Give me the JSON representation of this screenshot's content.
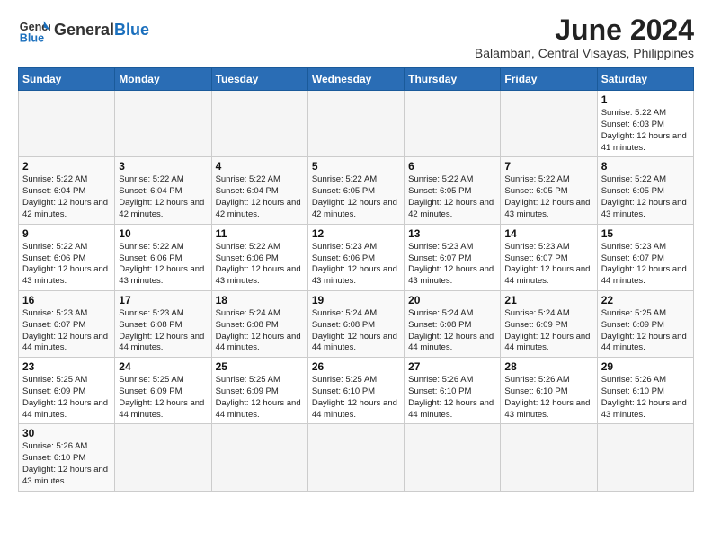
{
  "header": {
    "logo_general": "General",
    "logo_blue": "Blue",
    "month_year": "June 2024",
    "location": "Balamban, Central Visayas, Philippines"
  },
  "weekdays": [
    "Sunday",
    "Monday",
    "Tuesday",
    "Wednesday",
    "Thursday",
    "Friday",
    "Saturday"
  ],
  "weeks": [
    [
      {
        "day": "",
        "info": ""
      },
      {
        "day": "",
        "info": ""
      },
      {
        "day": "",
        "info": ""
      },
      {
        "day": "",
        "info": ""
      },
      {
        "day": "",
        "info": ""
      },
      {
        "day": "",
        "info": ""
      },
      {
        "day": "1",
        "info": "Sunrise: 5:22 AM\nSunset: 6:03 PM\nDaylight: 12 hours and 41 minutes."
      }
    ],
    [
      {
        "day": "2",
        "info": "Sunrise: 5:22 AM\nSunset: 6:04 PM\nDaylight: 12 hours and 42 minutes."
      },
      {
        "day": "3",
        "info": "Sunrise: 5:22 AM\nSunset: 6:04 PM\nDaylight: 12 hours and 42 minutes."
      },
      {
        "day": "4",
        "info": "Sunrise: 5:22 AM\nSunset: 6:04 PM\nDaylight: 12 hours and 42 minutes."
      },
      {
        "day": "5",
        "info": "Sunrise: 5:22 AM\nSunset: 6:05 PM\nDaylight: 12 hours and 42 minutes."
      },
      {
        "day": "6",
        "info": "Sunrise: 5:22 AM\nSunset: 6:05 PM\nDaylight: 12 hours and 42 minutes."
      },
      {
        "day": "7",
        "info": "Sunrise: 5:22 AM\nSunset: 6:05 PM\nDaylight: 12 hours and 43 minutes."
      },
      {
        "day": "8",
        "info": "Sunrise: 5:22 AM\nSunset: 6:05 PM\nDaylight: 12 hours and 43 minutes."
      }
    ],
    [
      {
        "day": "9",
        "info": "Sunrise: 5:22 AM\nSunset: 6:06 PM\nDaylight: 12 hours and 43 minutes."
      },
      {
        "day": "10",
        "info": "Sunrise: 5:22 AM\nSunset: 6:06 PM\nDaylight: 12 hours and 43 minutes."
      },
      {
        "day": "11",
        "info": "Sunrise: 5:22 AM\nSunset: 6:06 PM\nDaylight: 12 hours and 43 minutes."
      },
      {
        "day": "12",
        "info": "Sunrise: 5:23 AM\nSunset: 6:06 PM\nDaylight: 12 hours and 43 minutes."
      },
      {
        "day": "13",
        "info": "Sunrise: 5:23 AM\nSunset: 6:07 PM\nDaylight: 12 hours and 43 minutes."
      },
      {
        "day": "14",
        "info": "Sunrise: 5:23 AM\nSunset: 6:07 PM\nDaylight: 12 hours and 44 minutes."
      },
      {
        "day": "15",
        "info": "Sunrise: 5:23 AM\nSunset: 6:07 PM\nDaylight: 12 hours and 44 minutes."
      }
    ],
    [
      {
        "day": "16",
        "info": "Sunrise: 5:23 AM\nSunset: 6:07 PM\nDaylight: 12 hours and 44 minutes."
      },
      {
        "day": "17",
        "info": "Sunrise: 5:23 AM\nSunset: 6:08 PM\nDaylight: 12 hours and 44 minutes."
      },
      {
        "day": "18",
        "info": "Sunrise: 5:24 AM\nSunset: 6:08 PM\nDaylight: 12 hours and 44 minutes."
      },
      {
        "day": "19",
        "info": "Sunrise: 5:24 AM\nSunset: 6:08 PM\nDaylight: 12 hours and 44 minutes."
      },
      {
        "day": "20",
        "info": "Sunrise: 5:24 AM\nSunset: 6:08 PM\nDaylight: 12 hours and 44 minutes."
      },
      {
        "day": "21",
        "info": "Sunrise: 5:24 AM\nSunset: 6:09 PM\nDaylight: 12 hours and 44 minutes."
      },
      {
        "day": "22",
        "info": "Sunrise: 5:25 AM\nSunset: 6:09 PM\nDaylight: 12 hours and 44 minutes."
      }
    ],
    [
      {
        "day": "23",
        "info": "Sunrise: 5:25 AM\nSunset: 6:09 PM\nDaylight: 12 hours and 44 minutes."
      },
      {
        "day": "24",
        "info": "Sunrise: 5:25 AM\nSunset: 6:09 PM\nDaylight: 12 hours and 44 minutes."
      },
      {
        "day": "25",
        "info": "Sunrise: 5:25 AM\nSunset: 6:09 PM\nDaylight: 12 hours and 44 minutes."
      },
      {
        "day": "26",
        "info": "Sunrise: 5:25 AM\nSunset: 6:10 PM\nDaylight: 12 hours and 44 minutes."
      },
      {
        "day": "27",
        "info": "Sunrise: 5:26 AM\nSunset: 6:10 PM\nDaylight: 12 hours and 44 minutes."
      },
      {
        "day": "28",
        "info": "Sunrise: 5:26 AM\nSunset: 6:10 PM\nDaylight: 12 hours and 43 minutes."
      },
      {
        "day": "29",
        "info": "Sunrise: 5:26 AM\nSunset: 6:10 PM\nDaylight: 12 hours and 43 minutes."
      }
    ],
    [
      {
        "day": "30",
        "info": "Sunrise: 5:26 AM\nSunset: 6:10 PM\nDaylight: 12 hours and 43 minutes."
      },
      {
        "day": "",
        "info": ""
      },
      {
        "day": "",
        "info": ""
      },
      {
        "day": "",
        "info": ""
      },
      {
        "day": "",
        "info": ""
      },
      {
        "day": "",
        "info": ""
      },
      {
        "day": "",
        "info": ""
      }
    ]
  ]
}
